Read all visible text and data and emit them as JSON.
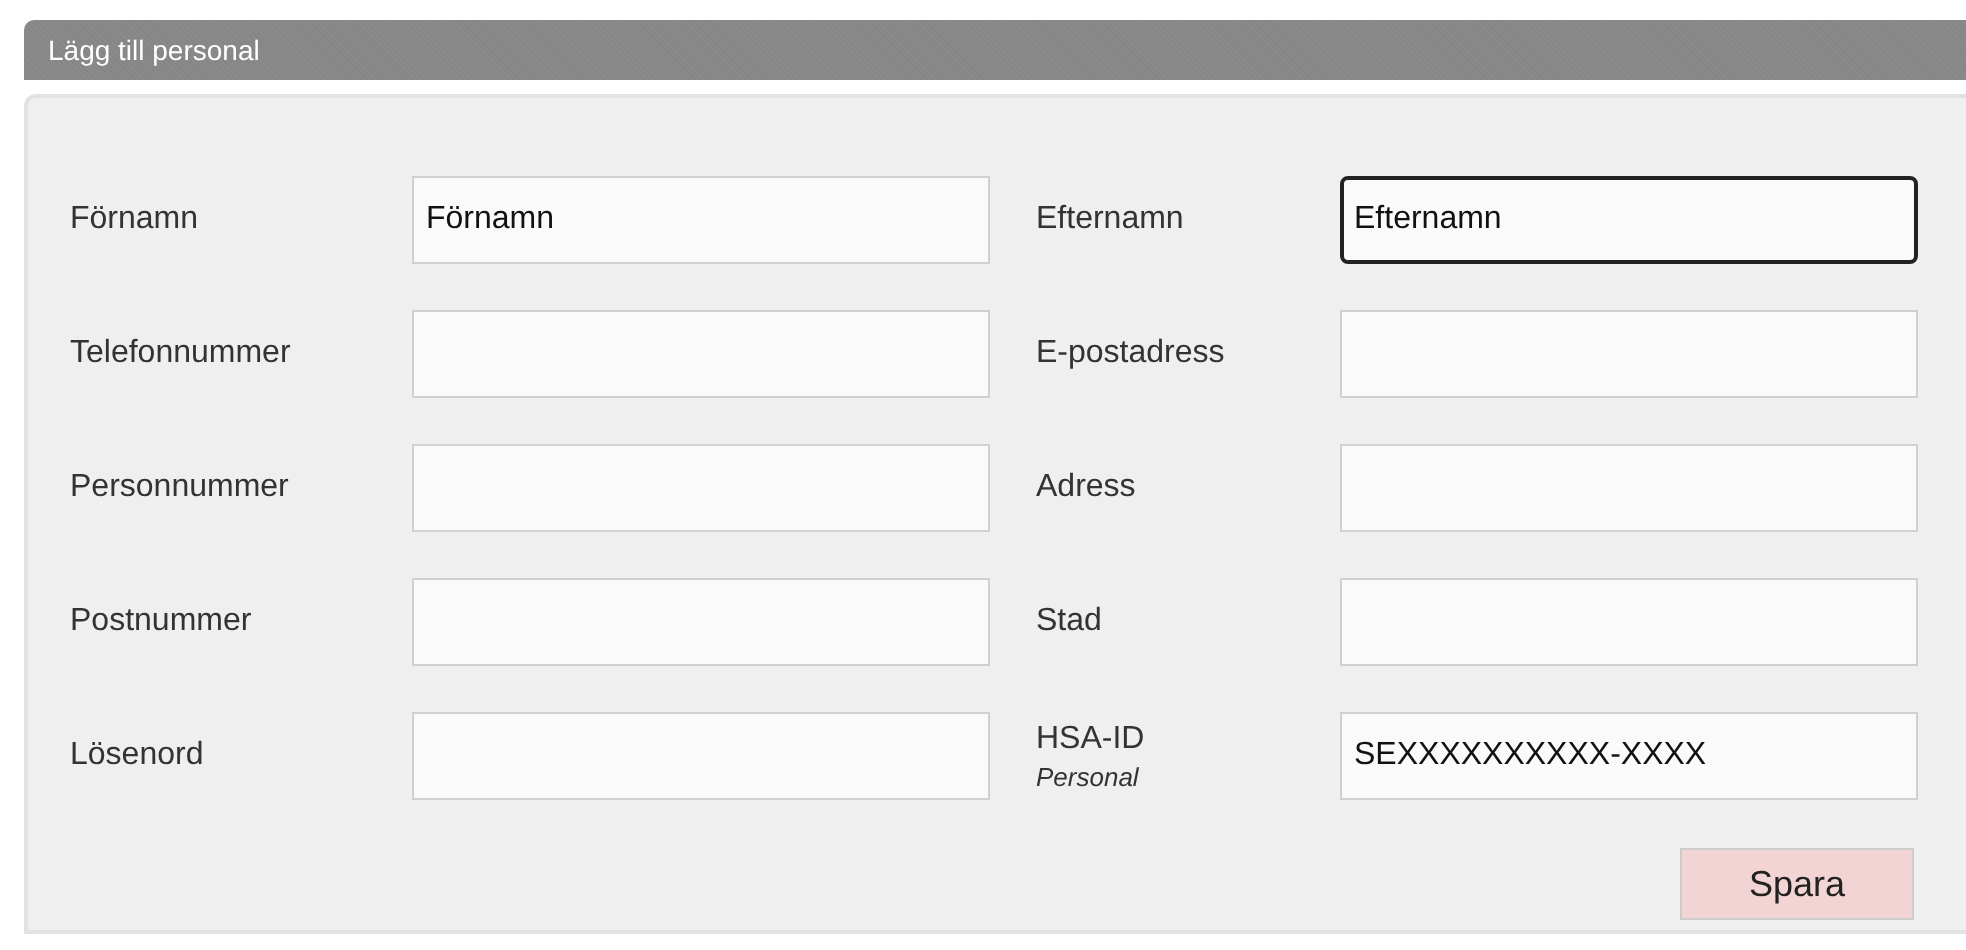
{
  "panel": {
    "title": "Lägg till personal"
  },
  "fields": [
    {
      "label": "Förnamn",
      "value": "Förnamn",
      "focused": false
    },
    {
      "label": "Efternamn",
      "value": "Efternamn",
      "focused": true
    },
    {
      "label": "Telefonnummer",
      "focused": false
    },
    {
      "label": "E-postadress",
      "focused": false
    },
    {
      "label": "Personnummer",
      "focused": false
    },
    {
      "label": "Adress",
      "focused": false
    },
    {
      "label": "Postnummer",
      "focused": false
    },
    {
      "label": "Stad",
      "focused": false
    },
    {
      "label": "Lösenord",
      "focused": false
    },
    {
      "label": "HSA-ID",
      "sublabel": "Personal",
      "value": "SEXXXXXXXXXX-XXXX",
      "focused": false
    }
  ],
  "buttons": [
    {
      "label": "Spara"
    }
  ]
}
